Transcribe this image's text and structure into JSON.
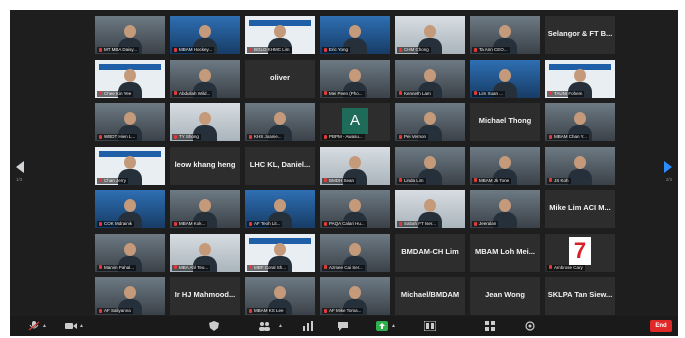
{
  "nav": {
    "left_page": "1/3",
    "right_page": "2/3"
  },
  "tiles": [
    {
      "name": "MT MBA Daisy...",
      "kind": "video"
    },
    {
      "name": "MBAM Hockey...",
      "kind": "blue"
    },
    {
      "name": "BGLO KHMC Lim",
      "kind": "banner"
    },
    {
      "name": "Eric Yong",
      "kind": "blue"
    },
    {
      "name": "CHM Chong",
      "kind": "bright"
    },
    {
      "name": "Ta Ann CEO...",
      "kind": "video"
    },
    {
      "name": "Selangor & FT B...",
      "kind": "text"
    },
    {
      "name": "Chee Kin Yee",
      "kind": "banner"
    },
    {
      "name": "Abdullah Wild...",
      "kind": "video"
    },
    {
      "name": "oliver",
      "kind": "text"
    },
    {
      "name": "Mei Peen (Pho...",
      "kind": "video"
    },
    {
      "name": "Kenneth Lam",
      "kind": "video"
    },
    {
      "name": "Lim Xuan ...",
      "kind": "blue"
    },
    {
      "name": "TAUNI Fohem",
      "kind": "banner"
    },
    {
      "name": "WBDT Hien L...",
      "kind": "video"
    },
    {
      "name": "TY Shong",
      "kind": "bright"
    },
    {
      "name": "KHS Joanie...",
      "kind": "video"
    },
    {
      "name": "PBPM - Awasu...",
      "kind": "logo-a"
    },
    {
      "name": "Pei Vernon",
      "kind": "video"
    },
    {
      "name": "Michael Thong",
      "kind": "text"
    },
    {
      "name": "MBAM Chan Y...",
      "kind": "video"
    },
    {
      "name": "Chan Jerry",
      "kind": "banner"
    },
    {
      "name": "leow khang heng",
      "kind": "text"
    },
    {
      "name": "LHC KL, Daniel...",
      "kind": "text"
    },
    {
      "name": "BMDH Sean",
      "kind": "bright"
    },
    {
      "name": "Linda Lim",
      "kind": "video"
    },
    {
      "name": "MBAM Jk Tone",
      "kind": "video"
    },
    {
      "name": "JS Koh",
      "kind": "video"
    },
    {
      "name": "COK Mdrainik",
      "kind": "blue"
    },
    {
      "name": "MBAM Kok...",
      "kind": "video"
    },
    {
      "name": "AF Teoh Lit...",
      "kind": "blue"
    },
    {
      "name": "PAQA Calari Hu...",
      "kind": "video"
    },
    {
      "name": "Sabah FT Iser...",
      "kind": "bright"
    },
    {
      "name": "Jeeralan",
      "kind": "video"
    },
    {
      "name": "Mike Lim ACI M...",
      "kind": "text"
    },
    {
      "name": "Marvin Pahal...",
      "kind": "video"
    },
    {
      "name": "MBA Ahl Teo...",
      "kind": "bright"
    },
    {
      "name": "MBF Coral Sh...",
      "kind": "banner"
    },
    {
      "name": "Azmee Cai Ser...",
      "kind": "video"
    },
    {
      "name": "BMDAM-CH Lim",
      "kind": "text"
    },
    {
      "name": "MBAM Loh Mei...",
      "kind": "text"
    },
    {
      "name": "Ambrose Cary",
      "kind": "logo-7"
    },
    {
      "name": "AF Saliyanna",
      "kind": "video"
    },
    {
      "name": "Ir HJ Mahmood...",
      "kind": "text"
    },
    {
      "name": "MBAM KS Lee",
      "kind": "video"
    },
    {
      "name": "AF Mike Toma...",
      "kind": "video"
    },
    {
      "name": "Michael/BMDAM",
      "kind": "text"
    },
    {
      "name": "Jean Wong",
      "kind": "text"
    },
    {
      "name": "SKLPA Tan Siew...",
      "kind": "text"
    }
  ],
  "toolbar": {
    "end_label": "End"
  },
  "colors": {
    "meeting_bg": "#1e1e1e",
    "tile_bg": "#2d2d2d",
    "accent": "#2d8cff",
    "end": "#e02828",
    "muted_mic": "#e23a3a"
  }
}
